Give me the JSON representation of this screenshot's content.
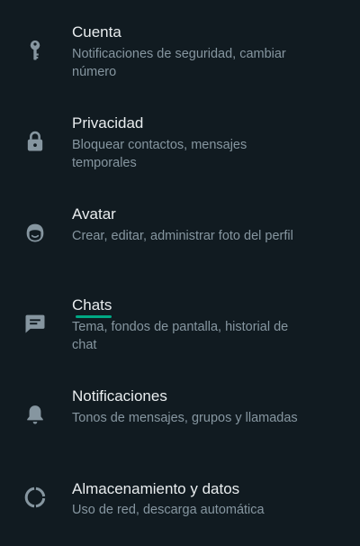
{
  "colors": {
    "background": "#111b21",
    "title": "#e9edef",
    "subtitle": "#8696a0",
    "icon": "#8696a0",
    "accent": "#00a884"
  },
  "settings": {
    "items": [
      {
        "icon": "key-icon",
        "title": "Cuenta",
        "subtitle": "Notificaciones de seguridad, cambiar número"
      },
      {
        "icon": "lock-icon",
        "title": "Privacidad",
        "subtitle": "Bloquear contactos, mensajes temporales"
      },
      {
        "icon": "avatar-face-icon",
        "title": "Avatar",
        "subtitle": "Crear, editar, administrar foto del perfil"
      },
      {
        "icon": "chat-icon",
        "title": "Chats",
        "subtitle": "Tema, fondos de pantalla, historial de chat",
        "highlighted": true
      },
      {
        "icon": "bell-icon",
        "title": "Notificaciones",
        "subtitle": "Tonos de mensajes, grupos y llamadas"
      },
      {
        "icon": "storage-circle-icon",
        "title": "Almacenamiento y datos",
        "subtitle": "Uso de red, descarga automática"
      }
    ]
  }
}
